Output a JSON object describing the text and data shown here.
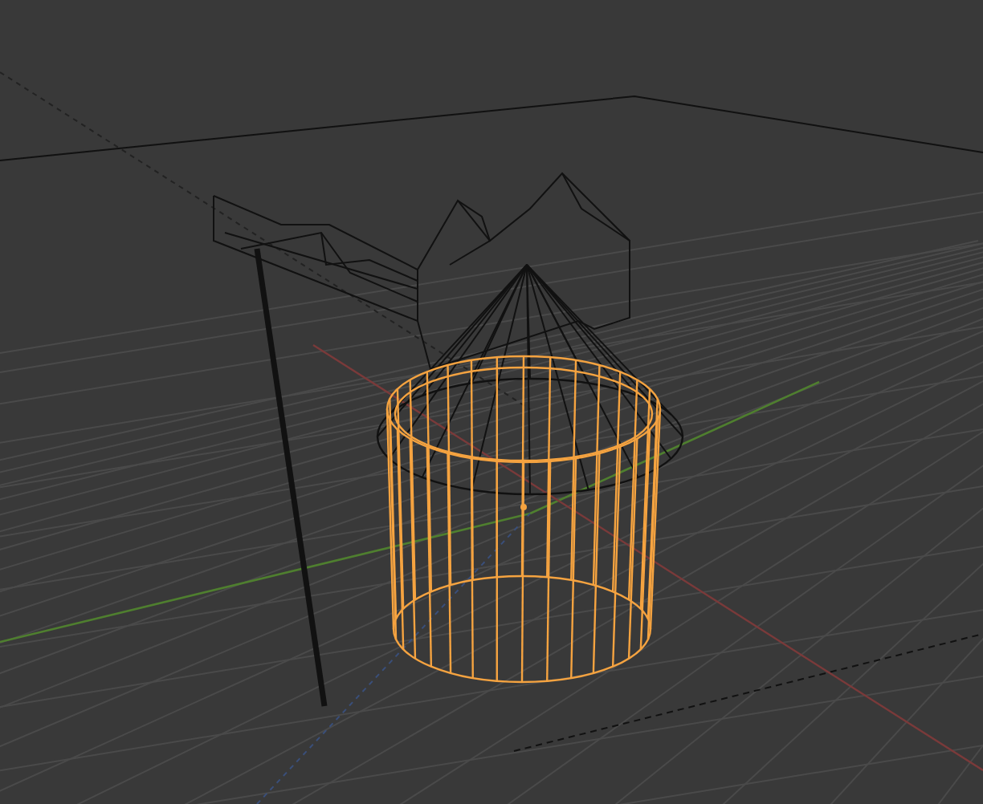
{
  "viewport": {
    "objects": [
      {
        "kind": "house",
        "selected": false
      },
      {
        "kind": "pole",
        "selected": false
      },
      {
        "kind": "cone",
        "selected": false
      },
      {
        "kind": "cylinder",
        "selected": true
      }
    ]
  }
}
